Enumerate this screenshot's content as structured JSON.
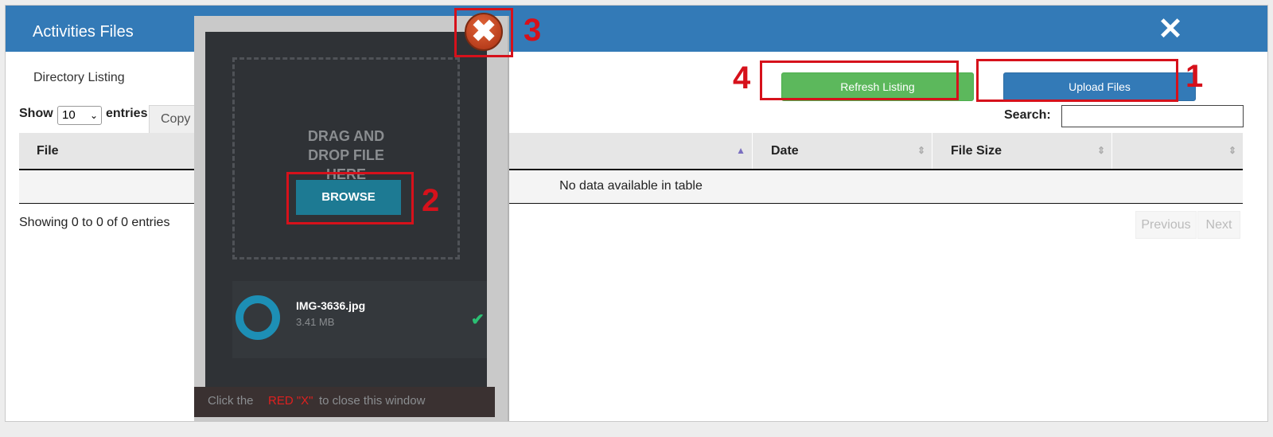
{
  "modal": {
    "title": "Activities Files",
    "close_icon": "close-icon",
    "directory_label": "Directory Listing"
  },
  "toolbar": {
    "refresh_label": "Refresh Listing",
    "upload_label": "Upload Files",
    "refresh_color": "#5cb85c",
    "upload_color": "#337ab7"
  },
  "table_controls": {
    "show_label": "Show",
    "page_size": "10",
    "entries_label": "entries",
    "copy_label": "Copy",
    "search_label": "Search:",
    "search_value": ""
  },
  "table": {
    "columns": [
      "File",
      "Date",
      "File Size",
      ""
    ],
    "empty_message": "No data available in table",
    "info": "Showing 0 to 0 of 0 entries",
    "prev_label": "Previous",
    "next_label": "Next"
  },
  "uploader": {
    "drop_text": "DRAG AND\nDROP FILE\nHERE",
    "browse_label": "BROWSE",
    "file": {
      "name": "IMG-3636.jpg",
      "size": "3.41 MB",
      "status_icon": "check-icon"
    },
    "note_prefix": "Click the",
    "note_highlight": "RED \"X\"",
    "note_suffix": "to close this window"
  },
  "callouts": {
    "upload": "1",
    "browse": "2",
    "close": "3",
    "refresh": "4",
    "color": "#d6111b"
  }
}
